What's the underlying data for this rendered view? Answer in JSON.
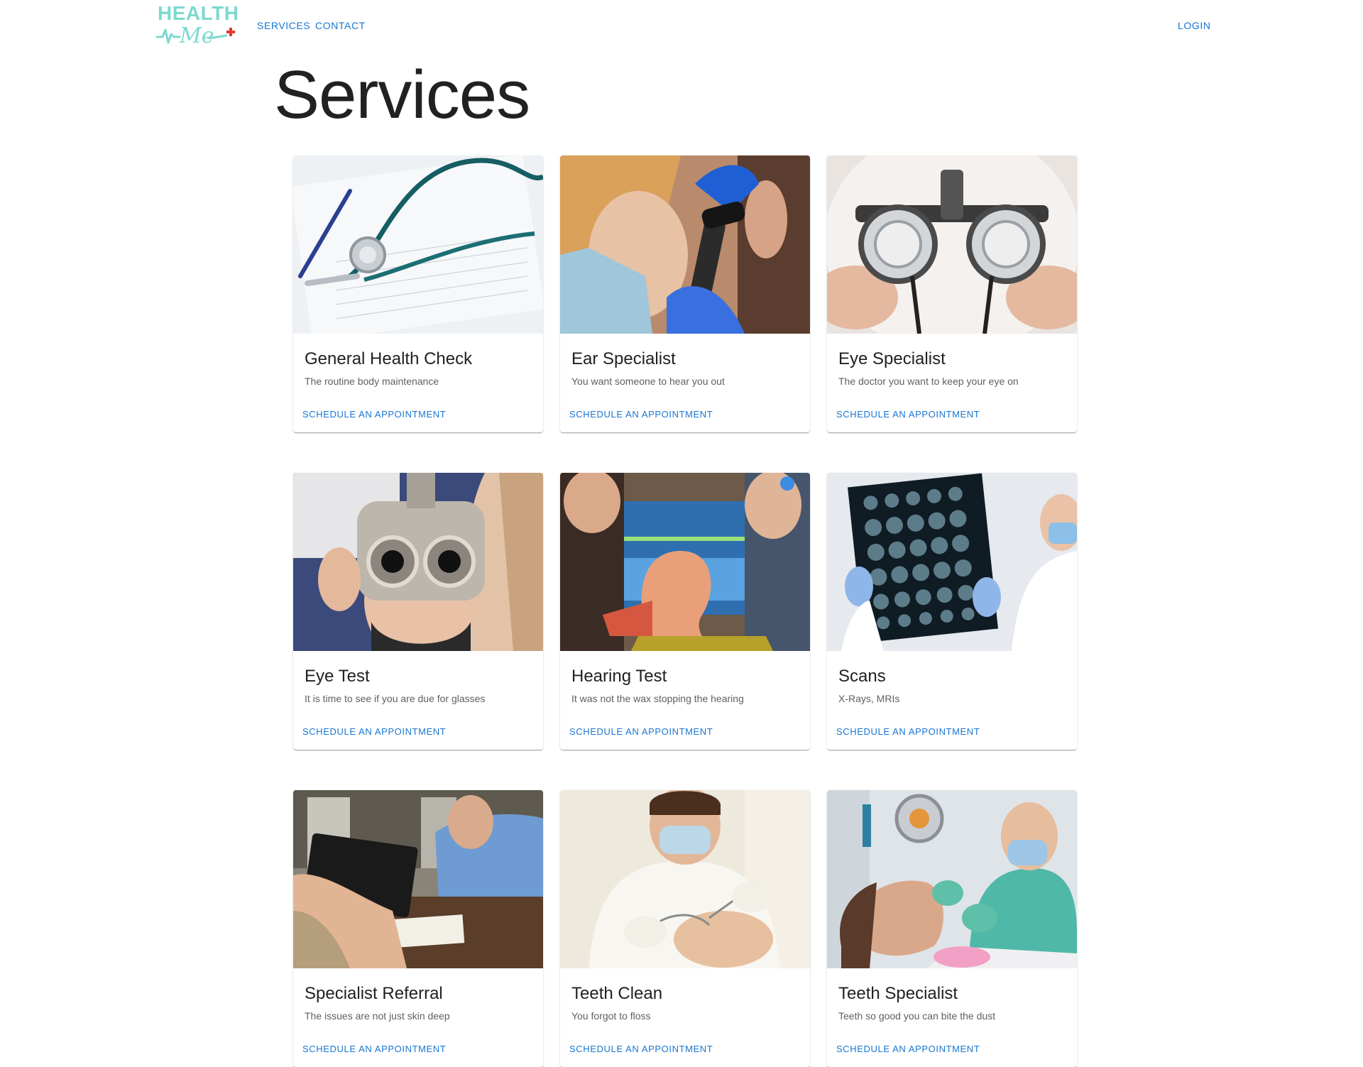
{
  "brand": {
    "logo_text": "HEALTH",
    "logo_script": "Me",
    "accent": "#7dd9cf",
    "cross_color": "#e53935"
  },
  "nav": {
    "services": "SERVICES",
    "contact": "CONTACT",
    "login": "LOGIN"
  },
  "page": {
    "title": "Services"
  },
  "action_label": "SCHEDULE AN APPOINTMENT",
  "cards": [
    {
      "title": "General Health Check",
      "desc": "The routine body maintenance",
      "image": "stethoscope-photo"
    },
    {
      "title": "Ear Specialist",
      "desc": "You want someone to hear you out",
      "image": "otoscope-ear-exam-photo"
    },
    {
      "title": "Eye Specialist",
      "desc": "The doctor you want to keep your eye on",
      "image": "trial-frame-glasses-photo"
    },
    {
      "title": "Eye Test",
      "desc": "It is time to see if you are due for glasses",
      "image": "phoropter-eye-test-photo"
    },
    {
      "title": "Hearing Test",
      "desc": "It was not the wax stopping the hearing",
      "image": "ear-model-hearing-test-photo"
    },
    {
      "title": "Scans",
      "desc": "X-Rays, MRIs",
      "image": "mri-scan-film-photo"
    },
    {
      "title": "Specialist Referral",
      "desc": "The issues are not just skin deep",
      "image": "consultation-desk-photo"
    },
    {
      "title": "Teeth Clean",
      "desc": "You forgot to floss",
      "image": "dentist-cleaning-photo"
    },
    {
      "title": "Teeth Specialist",
      "desc": "Teeth so good you can bite the dust",
      "image": "dental-surgery-photo"
    }
  ]
}
